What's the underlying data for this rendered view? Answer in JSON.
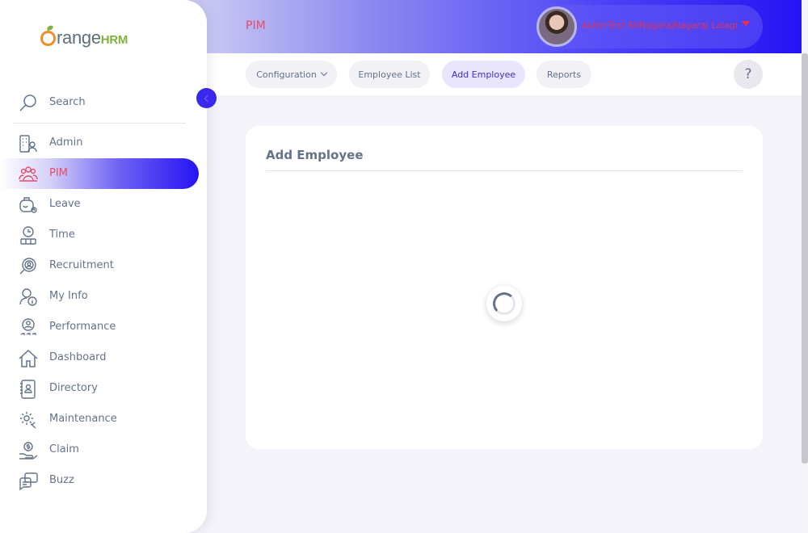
{
  "header": {
    "module_title": "PIM",
    "user_name": "AsherTest 60NagarajNagaraj Lalagi"
  },
  "tabs": [
    {
      "label": "Configuration",
      "has_dropdown": true,
      "active": false
    },
    {
      "label": "Employee List",
      "active": false
    },
    {
      "label": "Add Employee",
      "active": true
    },
    {
      "label": "Reports",
      "active": false
    }
  ],
  "help": {
    "label": "?"
  },
  "sidebar": {
    "logo": {
      "text": "range",
      "suffix": "HRM"
    },
    "search_label": "Search",
    "items": [
      {
        "label": "Admin",
        "icon": "admin-icon"
      },
      {
        "label": "PIM",
        "icon": "pim-icon",
        "active": true
      },
      {
        "label": "Leave",
        "icon": "leave-icon"
      },
      {
        "label": "Time",
        "icon": "time-icon"
      },
      {
        "label": "Recruitment",
        "icon": "recruitment-icon"
      },
      {
        "label": "My Info",
        "icon": "my-info-icon"
      },
      {
        "label": "Performance",
        "icon": "performance-icon"
      },
      {
        "label": "Dashboard",
        "icon": "dashboard-icon"
      },
      {
        "label": "Directory",
        "icon": "directory-icon"
      },
      {
        "label": "Maintenance",
        "icon": "maintenance-icon"
      },
      {
        "label": "Claim",
        "icon": "claim-icon"
      },
      {
        "label": "Buzz",
        "icon": "buzz-icon"
      }
    ]
  },
  "card": {
    "title": "Add Employee",
    "loading": true
  },
  "colors": {
    "accent": "#2414f3",
    "active_text": "#e34c6a",
    "text": "#64728c",
    "logo_orange": "#f28c28",
    "logo_green": "#7fb340"
  }
}
